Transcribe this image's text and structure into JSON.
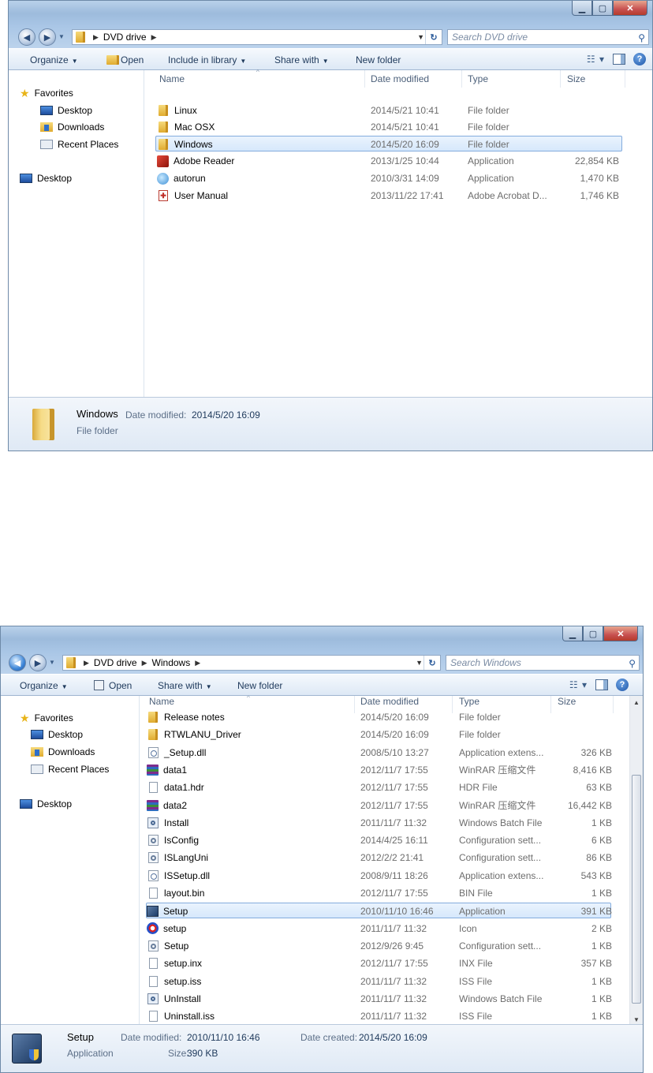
{
  "window1": {
    "address": {
      "segments": [
        "DVD drive"
      ]
    },
    "search_placeholder": "Search DVD drive",
    "toolbar": {
      "organize": "Organize",
      "open": "Open",
      "include_in_library": "Include in library",
      "share_with": "Share with",
      "new_folder": "New folder"
    },
    "nav": {
      "favorites": "Favorites",
      "desktop": "Desktop",
      "downloads": "Downloads",
      "recent_places": "Recent Places",
      "desktop_root": "Desktop"
    },
    "columns": {
      "name": "Name",
      "date": "Date modified",
      "type": "Type",
      "size": "Size"
    },
    "files": [
      {
        "name": "Linux",
        "date": "2014/5/21 10:41",
        "type": "File folder",
        "size": "",
        "icon": "folder-icon"
      },
      {
        "name": "Mac OSX",
        "date": "2014/5/21 10:41",
        "type": "File folder",
        "size": "",
        "icon": "folder-icon"
      },
      {
        "name": "Windows",
        "date": "2014/5/20 16:09",
        "type": "File folder",
        "size": "",
        "icon": "folder-icon"
      },
      {
        "name": "Adobe Reader",
        "date": "2013/1/25 10:44",
        "type": "Application",
        "size": "22,854 KB",
        "icon": "adobe-reader-icon"
      },
      {
        "name": "autorun",
        "date": "2010/3/31 14:09",
        "type": "Application",
        "size": "1,470 KB",
        "icon": "autorun-icon"
      },
      {
        "name": "User Manual",
        "date": "2013/11/22 17:41",
        "type": "Adobe Acrobat D...",
        "size": "1,746 KB",
        "icon": "pdf-icon"
      }
    ],
    "selected_index": 2,
    "details": {
      "name": "Windows",
      "date_label": "Date modified:",
      "date_value": "2014/5/20 16:09",
      "type": "File folder"
    }
  },
  "window2": {
    "address": {
      "segments": [
        "DVD drive",
        "Windows"
      ]
    },
    "search_placeholder": "Search Windows",
    "toolbar": {
      "organize": "Organize",
      "open": "Open",
      "share_with": "Share with",
      "new_folder": "New folder"
    },
    "nav": {
      "favorites": "Favorites",
      "desktop": "Desktop",
      "downloads": "Downloads",
      "recent_places": "Recent Places",
      "desktop_root": "Desktop"
    },
    "columns": {
      "name": "Name",
      "date": "Date modified",
      "type": "Type",
      "size": "Size"
    },
    "files": [
      {
        "name": "Release notes",
        "date": "2014/5/20 16:09",
        "type": "File folder",
        "size": "",
        "icon": "folder-icon"
      },
      {
        "name": "RTWLANU_Driver",
        "date": "2014/5/20 16:09",
        "type": "File folder",
        "size": "",
        "icon": "folder-icon"
      },
      {
        "name": "_Setup.dll",
        "date": "2008/5/10 13:27",
        "type": "Application extens...",
        "size": "326 KB",
        "icon": "dll-icon"
      },
      {
        "name": "data1",
        "date": "2012/11/7 17:55",
        "type": "WinRAR 压缩文件",
        "size": "8,416 KB",
        "icon": "winrar-icon"
      },
      {
        "name": "data1.hdr",
        "date": "2012/11/7 17:55",
        "type": "HDR File",
        "size": "63 KB",
        "icon": "file-icon"
      },
      {
        "name": "data2",
        "date": "2012/11/7 17:55",
        "type": "WinRAR 压缩文件",
        "size": "16,442 KB",
        "icon": "winrar-icon"
      },
      {
        "name": "Install",
        "date": "2011/11/7 11:32",
        "type": "Windows Batch File",
        "size": "1 KB",
        "icon": "batch-file-icon"
      },
      {
        "name": "IsConfig",
        "date": "2014/4/25 16:11",
        "type": "Configuration sett...",
        "size": "6 KB",
        "icon": "config-icon"
      },
      {
        "name": "ISLangUni",
        "date": "2012/2/2 21:41",
        "type": "Configuration sett...",
        "size": "86 KB",
        "icon": "config-icon"
      },
      {
        "name": "ISSetup.dll",
        "date": "2008/9/11 18:26",
        "type": "Application extens...",
        "size": "543 KB",
        "icon": "dll-icon"
      },
      {
        "name": "layout.bin",
        "date": "2012/11/7 17:55",
        "type": "BIN File",
        "size": "1 KB",
        "icon": "file-icon"
      },
      {
        "name": "Setup",
        "date": "2010/11/10 16:46",
        "type": "Application",
        "size": "391 KB",
        "icon": "setup-exe-icon"
      },
      {
        "name": "setup",
        "date": "2011/11/7 11:32",
        "type": "Icon",
        "size": "2 KB",
        "icon": "setup-ico-icon"
      },
      {
        "name": "Setup",
        "date": "2012/9/26 9:45",
        "type": "Configuration sett...",
        "size": "1 KB",
        "icon": "config-icon"
      },
      {
        "name": "setup.inx",
        "date": "2012/11/7 17:55",
        "type": "INX File",
        "size": "357 KB",
        "icon": "file-icon"
      },
      {
        "name": "setup.iss",
        "date": "2011/11/7 11:32",
        "type": "ISS File",
        "size": "1 KB",
        "icon": "file-icon"
      },
      {
        "name": "UnInstall",
        "date": "2011/11/7 11:32",
        "type": "Windows Batch File",
        "size": "1 KB",
        "icon": "batch-file-icon"
      },
      {
        "name": "Uninstall.iss",
        "date": "2011/11/7 11:32",
        "type": "ISS File",
        "size": "1 KB",
        "icon": "file-icon"
      }
    ],
    "selected_index": 11,
    "details": {
      "name": "Setup",
      "type": "Application",
      "date_modified_label": "Date modified:",
      "date_modified_value": "2010/11/10 16:46",
      "size_label": "Size:",
      "size_value": "390 KB",
      "date_created_label": "Date created:",
      "date_created_value": "2014/5/20 16:09"
    }
  },
  "colors": {
    "selection": "#d6e8fc",
    "selection_border": "#84acdd",
    "chrome": "#a9c6e6"
  }
}
